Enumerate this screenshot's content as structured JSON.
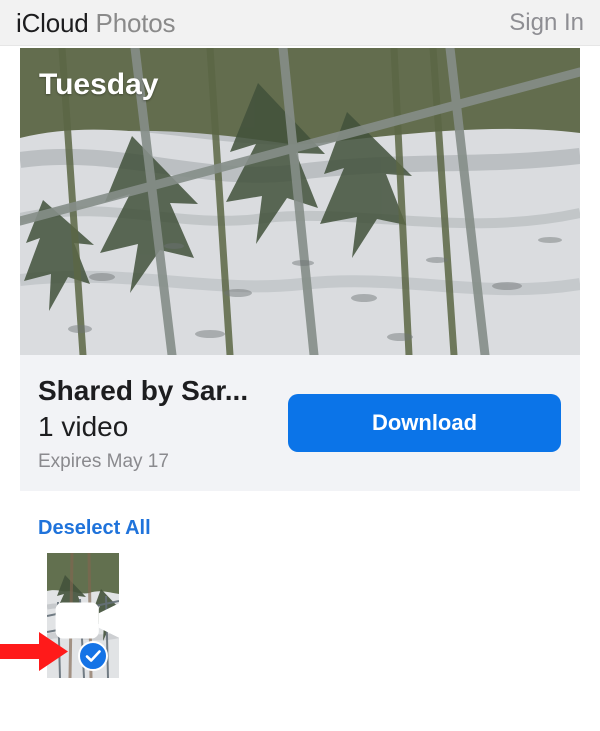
{
  "header": {
    "brand_part1": "iCloud",
    "brand_part2": "Photos",
    "sign_in_label": "Sign In"
  },
  "album": {
    "day_label": "Tuesday",
    "shared_by": "Shared by Sar...",
    "item_count": "1 video",
    "expires_label": "Expires May 17",
    "download_label": "Download"
  },
  "selection": {
    "deselect_all_label": "Deselect All",
    "items": [
      {
        "type": "video",
        "selected": true,
        "icon": "video-camera-icon",
        "selection_icon": "checkmark-icon"
      }
    ]
  },
  "annotation": {
    "icon": "red-arrow-icon",
    "color": "#ff1a1a"
  },
  "colors": {
    "accent": "#0b74e8",
    "link": "#1f73db",
    "header_bg": "#f2f2f2",
    "card_bg": "#f2f3f6"
  }
}
